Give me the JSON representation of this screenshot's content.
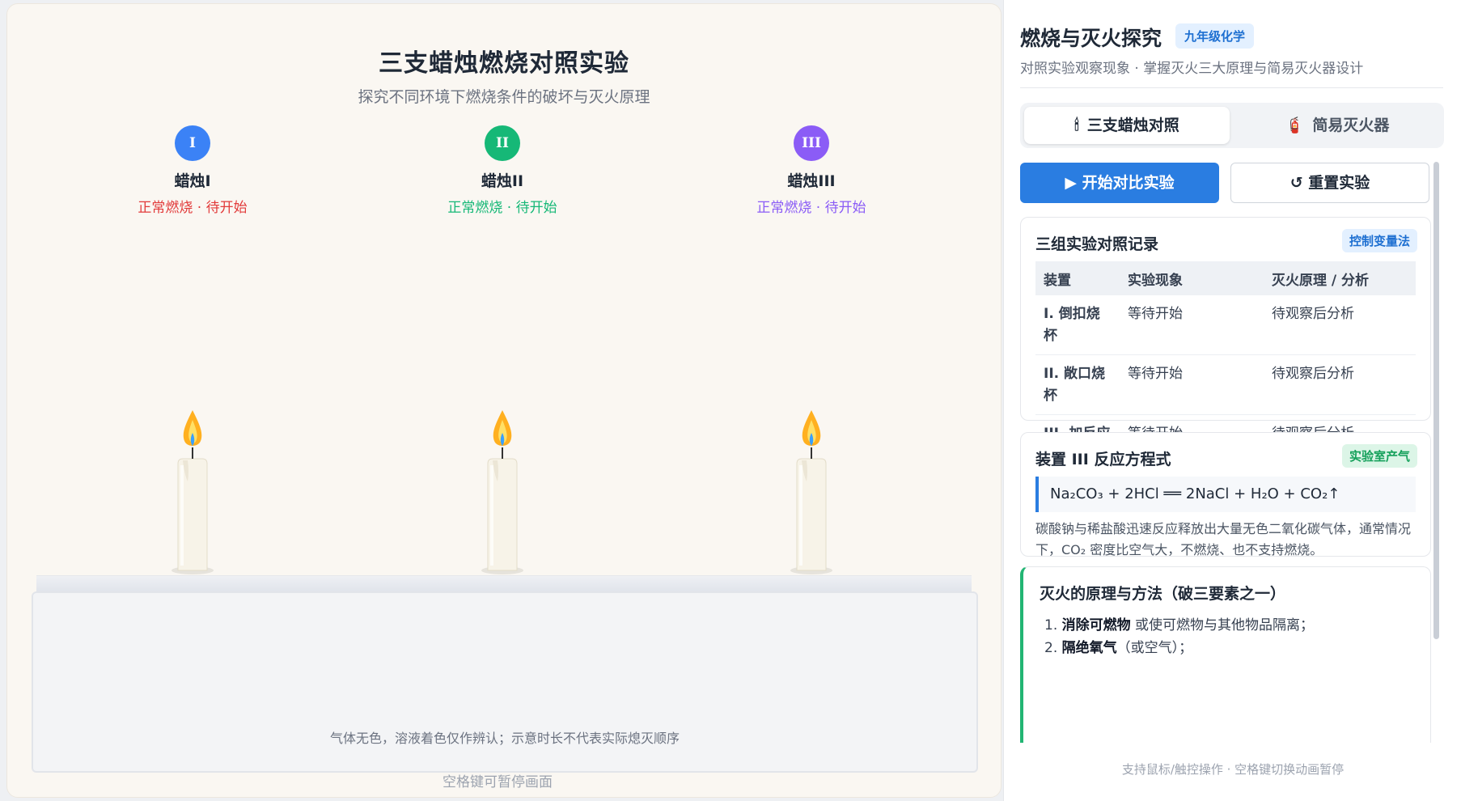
{
  "stage": {
    "title": "三支蜡烛燃烧对照实验",
    "subtitle": "探究不同环境下燃烧条件的破坏与灭火原理",
    "candles": [
      {
        "numeral": "I",
        "name": "蜡烛I",
        "status": "正常燃烧 · 待开始",
        "color": "#3b82f6",
        "status_color": "#e23b3b"
      },
      {
        "numeral": "II",
        "name": "蜡烛II",
        "status": "正常燃烧 · 待开始",
        "color": "#16b877",
        "status_color": "#16b877"
      },
      {
        "numeral": "III",
        "name": "蜡烛III",
        "status": "正常燃烧 · 待开始",
        "color": "#8b5cf6",
        "status_color": "#8b5cf6"
      }
    ],
    "tray_note": "气体无色，溶液着色仅作辨认；示意时长不代表实际熄灭顺序",
    "footer_hint": "空格键可暂停画面"
  },
  "panel": {
    "title": "燃烧与灭火探究",
    "tag": "九年级化学",
    "subtitle": "对照实验观察现象 · 掌握灭火三大原理与简易灭火器设计",
    "tabs": [
      {
        "label": "三支蜡烛对照",
        "icon": "candle-icon",
        "glyph": "🕯"
      },
      {
        "label": "简易灭火器",
        "icon": "fire-extinguisher-icon",
        "glyph": "🧯"
      }
    ],
    "start_button": "▶ 开始对比实验",
    "reset_button": "↺ 重置实验",
    "record": {
      "title": "三组实验对照记录",
      "tag": "控制变量法",
      "headers": [
        "装置",
        "实验现象",
        "灭火原理 / 分析"
      ],
      "rows": [
        {
          "device": "I. 倒扣烧杯",
          "phenomenon": "等待开始",
          "analysis": "待观察后分析"
        },
        {
          "device": "II. 敞口烧杯",
          "phenomenon": "等待开始",
          "analysis": "待观察后分析"
        },
        {
          "device": "III. 加反应剂",
          "phenomenon": "等待开始",
          "analysis": "待观察后分析"
        }
      ]
    },
    "equation": {
      "title": "装置 III 反应方程式",
      "tag": "实验室产气",
      "formula": "Na₂CO₃ + 2HCl ══ 2NaCl + H₂O + CO₂↑",
      "description": "碳酸钠与稀盐酸迅速反应释放出大量无色二氧化碳气体，通常情况下，CO₂ 密度比空气大，不燃烧、也不支持燃烧。"
    },
    "principles": {
      "title": "灭火的原理与方法（破三要素之一）",
      "items": [
        {
          "index": "1.",
          "bold": "消除可燃物",
          "rest": " 或使可燃物与其他物品隔离；"
        },
        {
          "index": "2.",
          "bold": "隔绝氧气",
          "rest": "（或空气）；"
        }
      ]
    },
    "footer_hint": "支持鼠标/触控操作 · 空格键切换动画暂停"
  },
  "colors": {
    "primary": "#2a7de1",
    "tag_blue_bg": "#e3f0ff",
    "tag_green_bg": "#dcf5e7",
    "tag_green_fg": "#14a05a",
    "principle_accent": "#22b573"
  }
}
